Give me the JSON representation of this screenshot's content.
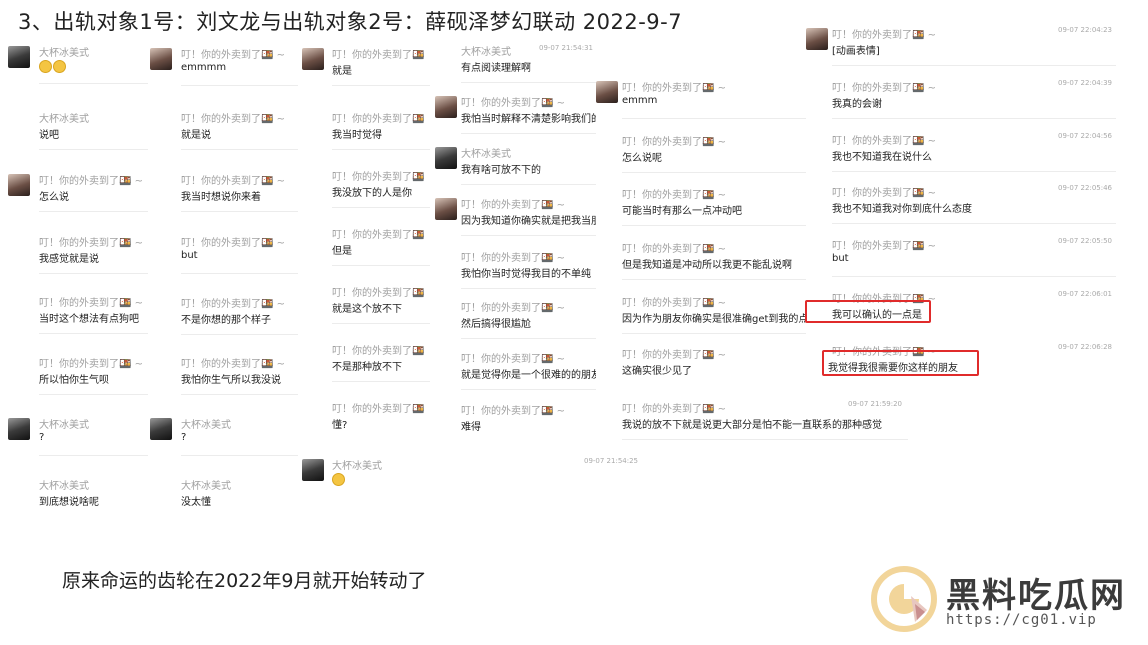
{
  "title": "3、出轨对象1号：刘文龙与出轨对象2号：薛砚泽梦幻联动   2022-9-7",
  "footer_text": "原来命运的齿轮在2022年9月就开始转动了",
  "watermark": {
    "site_name": "黑料吃瓜网",
    "url": "https://cg01.vip"
  },
  "colors": {
    "highlight": "#e02b2b",
    "name_gray": "#a0a0a0"
  },
  "panel1": {
    "items": [
      {
        "name": "大杯冰美式",
        "text": "😌😌",
        "avatar": "dark"
      },
      {
        "name": "大杯冰美式",
        "text": "说吧",
        "avatar": ""
      },
      {
        "name": "叮！你的外卖到了🍱 ~",
        "text": "怎么说",
        "avatar": "light"
      },
      {
        "name": "叮！你的外卖到了🍱 ~",
        "text": "我感觉就是说",
        "avatar": ""
      },
      {
        "name": "叮！你的外卖到了🍱 ~",
        "text": "当时这个想法有点狗吧",
        "avatar": ""
      },
      {
        "name": "叮！你的外卖到了🍱 ~",
        "text": "所以怕你生气呗",
        "avatar": ""
      },
      {
        "name": "大杯冰美式",
        "text": "?",
        "avatar": "dark"
      },
      {
        "name": "大杯冰美式",
        "text": "到底想说啥呢",
        "avatar": ""
      }
    ]
  },
  "panel2": {
    "items": [
      {
        "name": "叮！你的外卖到了🍱 ~",
        "text": "emmmm",
        "avatar": "light"
      },
      {
        "name": "叮！你的外卖到了🍱 ~",
        "text": "就是说",
        "avatar": ""
      },
      {
        "name": "叮！你的外卖到了🍱 ~",
        "text": "我当时想说你来着",
        "avatar": ""
      },
      {
        "name": "叮！你的外卖到了🍱 ~",
        "text": "but",
        "avatar": ""
      },
      {
        "name": "叮！你的外卖到了🍱 ~",
        "text": "不是你想的那个样子",
        "avatar": ""
      },
      {
        "name": "叮！你的外卖到了🍱 ~",
        "text": "我怕你生气所以我没说",
        "avatar": ""
      },
      {
        "name": "大杯冰美式",
        "text": "?",
        "avatar": "dark"
      },
      {
        "name": "大杯冰美式",
        "text": "没太懂",
        "avatar": ""
      }
    ]
  },
  "panel3": {
    "items": [
      {
        "name": "叮！你的外卖到了🍱",
        "text": "就是",
        "avatar": "light"
      },
      {
        "name": "叮！你的外卖到了🍱",
        "text": "我当时觉得",
        "avatar": ""
      },
      {
        "name": "叮！你的外卖到了🍱",
        "text": "我没放下的人是你",
        "avatar": ""
      },
      {
        "name": "叮！你的外卖到了🍱",
        "text": "但是",
        "avatar": ""
      },
      {
        "name": "叮！你的外卖到了🍱",
        "text": "就是这个放不下",
        "avatar": ""
      },
      {
        "name": "叮！你的外卖到了🍱",
        "text": "不是那种放不下",
        "avatar": ""
      },
      {
        "name": "叮！你的外卖到了🍱",
        "text": "懂?",
        "avatar": ""
      },
      {
        "name": "大杯冰美式",
        "text": "😌",
        "avatar": "dark",
        "time": "09-07 21:54:25"
      }
    ]
  },
  "panel4": {
    "items": [
      {
        "name": "大杯冰美式",
        "text": "有点阅读理解啊",
        "avatar": "",
        "time": "09-07 21:54:31"
      },
      {
        "name": "叮！你的外卖到了🍱 ~",
        "text": "我怕当时解释不清楚影响我们的关",
        "avatar": "light"
      },
      {
        "name": "大杯冰美式",
        "text": "我有啥可放不下的",
        "avatar": "dark"
      },
      {
        "name": "叮！你的外卖到了🍱 ~",
        "text": "因为我知道你确实就是把我当朋友",
        "avatar": "light"
      },
      {
        "name": "叮！你的外卖到了🍱 ~",
        "text": "我怕你当时觉得我目的不单纯",
        "avatar": ""
      },
      {
        "name": "叮！你的外卖到了🍱 ~",
        "text": "然后搞得很尴尬",
        "avatar": ""
      },
      {
        "name": "叮！你的外卖到了🍱 ~",
        "text": "就是觉得你是一个很难的的朋友啊",
        "avatar": ""
      },
      {
        "name": "叮！你的外卖到了🍱 ~",
        "text": "难得",
        "avatar": ""
      }
    ]
  },
  "panel5": {
    "items": [
      {
        "name": "叮！你的外卖到了🍱 ~",
        "text": "emmm",
        "avatar": "light"
      },
      {
        "name": "叮！你的外卖到了🍱 ~",
        "text": "怎么说呢",
        "avatar": ""
      },
      {
        "name": "叮！你的外卖到了🍱 ~",
        "text": "可能当时有那么一点冲动吧",
        "avatar": ""
      },
      {
        "name": "叮！你的外卖到了🍱 ~",
        "text": "但是我知道是冲动所以我更不能乱说啊",
        "avatar": ""
      },
      {
        "name": "叮！你的外卖到了🍱 ~",
        "text": "因为作为朋友你确实是很准确get到我的点",
        "avatar": ""
      },
      {
        "name": "叮！你的外卖到了🍱 ~",
        "text": "这确实很少见了",
        "avatar": ""
      },
      {
        "name": "叮！你的外卖到了🍱 ~",
        "text": "我说的放不下就是说更大部分是怕不能一直联系的那种感觉",
        "avatar": "",
        "time": "09-07 21:59:20"
      }
    ]
  },
  "panel6": {
    "items": [
      {
        "name": "叮！你的外卖到了🍱 ~",
        "text": "[动画表情]",
        "avatar": "light",
        "time": "09-07 22:04:23"
      },
      {
        "name": "叮！你的外卖到了🍱 ~",
        "text": "我真的会谢",
        "avatar": "",
        "time": "09-07 22:04:39"
      },
      {
        "name": "叮！你的外卖到了🍱 ~",
        "text": "我也不知道我在说什么",
        "avatar": "",
        "time": "09-07 22:04:56"
      },
      {
        "name": "叮！你的外卖到了🍱 ~",
        "text": "我也不知道我对你到底什么态度",
        "avatar": "",
        "time": "09-07 22:05:46"
      },
      {
        "name": "叮！你的外卖到了🍱 ~",
        "text": "but",
        "avatar": "",
        "time": "09-07 22:05:50"
      },
      {
        "name": "叮！你的外卖到了🍱 ~",
        "text": "我可以确认的一点是",
        "avatar": "",
        "time": "09-07 22:06:01"
      },
      {
        "name": "叮！你的外卖到了🍱 ~",
        "text": "我觉得我很需要你这样的朋友",
        "avatar": "",
        "time": "09-07 22:06:28"
      }
    ]
  }
}
